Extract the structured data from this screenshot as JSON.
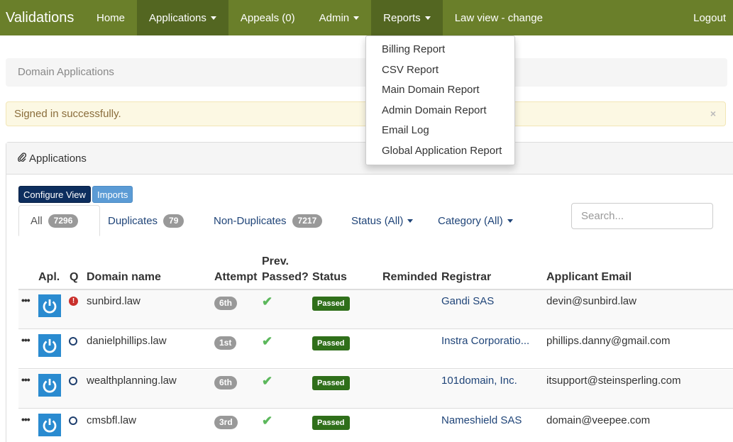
{
  "navbar": {
    "brand": "Validations",
    "items": [
      {
        "label": "Home",
        "has_caret": false
      },
      {
        "label": "Applications",
        "has_caret": true
      },
      {
        "label": "Appeals (0)",
        "has_caret": false
      },
      {
        "label": "Admin",
        "has_caret": true
      },
      {
        "label": "Reports",
        "has_caret": true
      },
      {
        "label": "Law view - change",
        "has_caret": false
      }
    ],
    "logout": "Logout"
  },
  "reports_menu": [
    "Billing Report",
    "CSV Report",
    "Main Domain Report",
    "Admin Domain Report",
    "Email Log",
    "Global Application Report"
  ],
  "breadcrumb": "Domain Applications",
  "alert": {
    "message": "Signed in successfully.",
    "close": "×"
  },
  "panel": {
    "title": "Applications",
    "icon": "paperclip-icon"
  },
  "buttons": {
    "configure_view": "Configure View",
    "imports": "Imports"
  },
  "tabs": [
    {
      "label": "All",
      "count": "7296"
    },
    {
      "label": "Duplicates",
      "count": "79"
    },
    {
      "label": "Non-Duplicates",
      "count": "7217"
    },
    {
      "label": "Status (All)"
    },
    {
      "label": "Category (All)"
    }
  ],
  "search": {
    "placeholder": "Search...",
    "value": ""
  },
  "columns": {
    "apl": "Apl.",
    "q": "Q",
    "domain": "Domain name",
    "attempt": "Attempt",
    "prev_line1": "Prev.",
    "prev_line2": "Passed?",
    "status": "Status",
    "reminded": "Reminded",
    "registrar": "Registrar",
    "email": "Applicant Email"
  },
  "rows": [
    {
      "domain": "sunbird.law",
      "attempt": "6th",
      "status": "Passed",
      "reminded": "",
      "registrar": "Gandi SAS",
      "email": "devin@sunbird.law",
      "q_icon": "alert-icon"
    },
    {
      "domain": "danielphillips.law",
      "attempt": "1st",
      "status": "Passed",
      "reminded": "",
      "registrar": "Instra Corporatio...",
      "email": "phillips.danny@gmail.com",
      "q_icon": "circle-icon"
    },
    {
      "domain": "wealthplanning.law",
      "attempt": "6th",
      "status": "Passed",
      "reminded": "",
      "registrar": "101domain, Inc.",
      "email": "itsupport@steinsperling.com",
      "q_icon": "circle-icon"
    },
    {
      "domain": "cmsbfl.law",
      "attempt": "3rd",
      "status": "Passed",
      "reminded": "",
      "registrar": "Nameshield SAS",
      "email": "domain@veepee.com",
      "q_icon": "circle-icon"
    }
  ],
  "row_menu_glyph": "•••",
  "check_glyph": "✔",
  "colors": {
    "navbar": "#6a7f2a",
    "navbar_active": "#536621",
    "passed": "#2f6f1a",
    "link": "#1f4478",
    "power_icon": "#2a8bd0"
  }
}
